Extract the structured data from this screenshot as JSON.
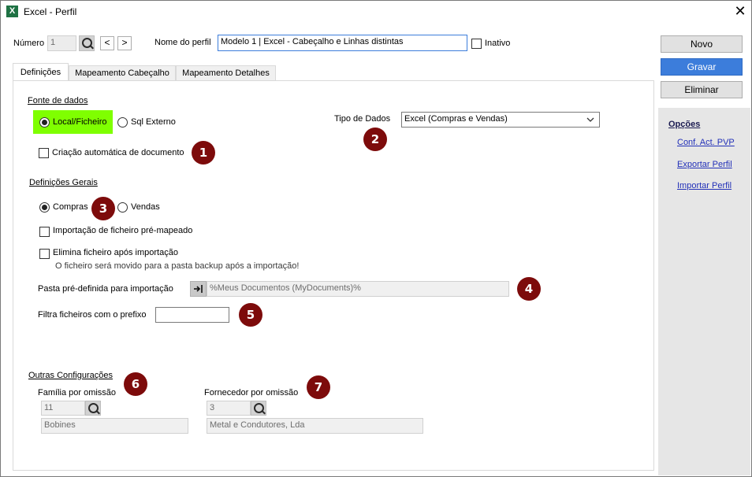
{
  "window": {
    "title": "Excel - Perfil",
    "app_icon": "X",
    "close_glyph": "✕"
  },
  "header": {
    "numero_label": "Número",
    "numero_value": "1",
    "prev_glyph": "<",
    "next_glyph": ">",
    "nome_label": "Nome do perfil",
    "nome_value": "Modelo 1 | Excel - Cabeçalho e Linhas distintas",
    "inativo_label": "Inativo"
  },
  "tabs": [
    {
      "label": "Definições"
    },
    {
      "label": "Mapeamento Cabeçalho"
    },
    {
      "label": "Mapeamento Detalhes"
    }
  ],
  "fonte": {
    "title": "Fonte de dados",
    "local_label": "Local/Ficheiro",
    "sql_label": "Sql Externo",
    "auto_doc_label": "Criação automática de documento",
    "tipo_label": "Tipo de Dados",
    "tipo_value": "Excel (Compras e Vendas)"
  },
  "gerais": {
    "title": "Definições Gerais",
    "compras_label": "Compras",
    "vendas_label": "Vendas",
    "premap_label": "Importação de ficheiro pré-mapeado",
    "elimina_label": "Elimina ficheiro após importação",
    "elimina_hint": "O ficheiro será movido para a pasta backup após a importação!",
    "pasta_label": "Pasta pré-definida para importação",
    "pasta_value": "%Meus Documentos (MyDocuments)%",
    "prefixo_label": "Filtra ficheiros com o prefixo",
    "prefixo_value": ""
  },
  "outras": {
    "title": "Outras Configurações",
    "familia_label": "Família por omissão",
    "familia_code": "11",
    "familia_name": "Bobines",
    "fornecedor_label": "Fornecedor por omissão",
    "fornecedor_code": "3",
    "fornecedor_name": "Metal e Condutores, Lda"
  },
  "badges": [
    "1",
    "2",
    "3",
    "4",
    "5",
    "6",
    "7"
  ],
  "actions": {
    "novo": "Novo",
    "gravar": "Gravar",
    "eliminar": "Eliminar"
  },
  "opcoes": {
    "title": "Opções",
    "links": [
      "Conf. Act. PVP",
      "Exportar Perfil",
      "Importar Perfil"
    ]
  },
  "colors": {
    "highlight": "#7fff00",
    "badge": "#7d0b0b",
    "primary": "#3c7ddb"
  }
}
